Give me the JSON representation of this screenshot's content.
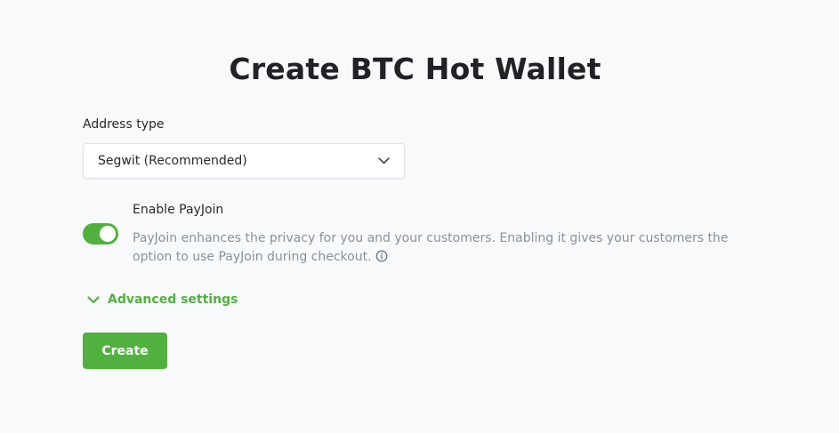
{
  "page": {
    "title": "Create BTC Hot Wallet"
  },
  "address_type": {
    "label": "Address type",
    "selected": "Segwit (Recommended)",
    "icon": "chevron-down-icon"
  },
  "payjoin": {
    "enabled": true,
    "title": "Enable PayJoin",
    "description": "PayJoin enhances the privacy for you and your customers. Enabling it gives your customers the option to use PayJoin during checkout.",
    "info_icon": "info-icon"
  },
  "advanced": {
    "label": "Advanced settings",
    "icon": "chevron-down-icon"
  },
  "actions": {
    "create_label": "Create"
  },
  "colors": {
    "accent": "#51b13e",
    "muted_text": "#8a9199",
    "background": "#f8f9fa"
  }
}
